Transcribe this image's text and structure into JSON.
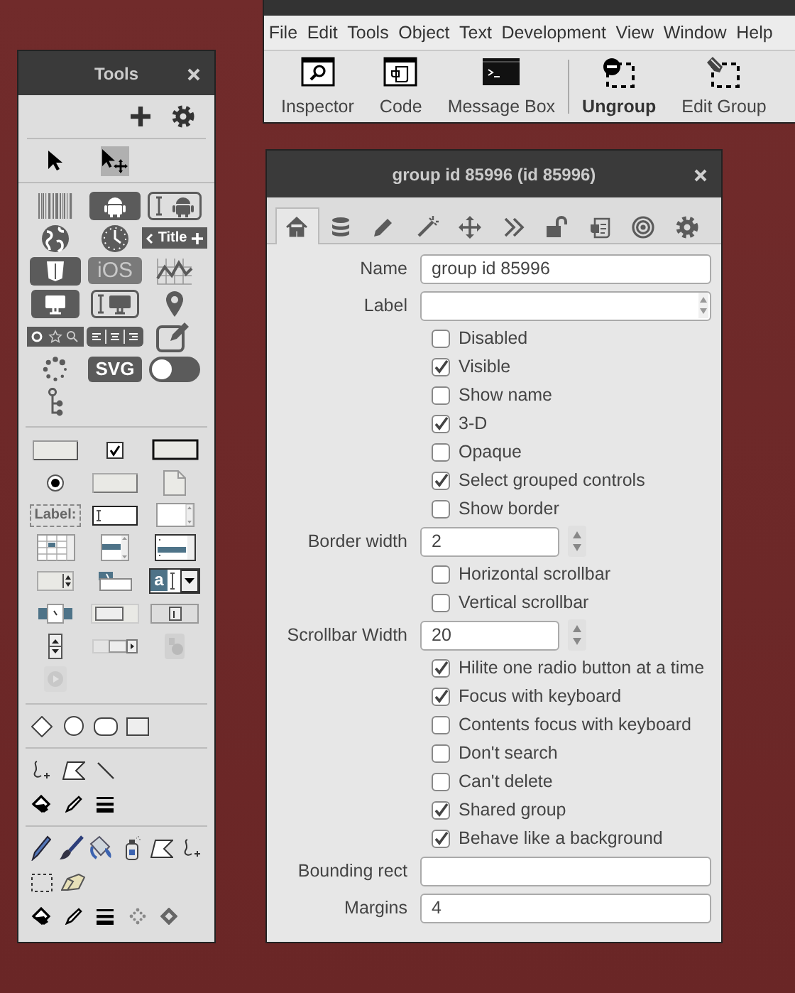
{
  "main_window": {
    "menu": [
      "File",
      "Edit",
      "Tools",
      "Object",
      "Text",
      "Development",
      "View",
      "Window",
      "Help"
    ],
    "toolbar_groups": [
      [
        {
          "kind": "inspector",
          "label": "Inspector",
          "emphasized": false
        },
        {
          "kind": "code",
          "label": "Code",
          "emphasized": false
        },
        {
          "kind": "console",
          "label": "Message Box",
          "emphasized": false
        }
      ],
      [
        {
          "kind": "ungroup",
          "label": "Ungroup",
          "emphasized": true
        },
        {
          "kind": "edit-group",
          "label": "Edit Group",
          "emphasized": false
        }
      ]
    ]
  },
  "tools": {
    "title": "Tools",
    "header_icons": [
      {
        "kind": "plus"
      },
      {
        "kind": "gear"
      }
    ],
    "pointers": [
      {
        "kind": "arrow",
        "selected": false
      },
      {
        "kind": "arrow-move",
        "selected": true
      }
    ],
    "sections": [
      {
        "kind": "grid",
        "rows": [
          [
            {
              "kind": "barcode"
            },
            {
              "kind": "android"
            },
            {
              "kind": "android-field"
            }
          ],
          [
            {
              "kind": "globe"
            },
            {
              "kind": "clock"
            },
            {
              "kind": "navbar",
              "label": "Title"
            }
          ],
          [
            {
              "kind": "html5"
            },
            {
              "kind": "ios",
              "label": "iOS"
            },
            {
              "kind": "chart"
            }
          ],
          [
            {
              "kind": "monitor"
            },
            {
              "kind": "monitor-field"
            },
            {
              "kind": "pin"
            }
          ],
          [
            {
              "kind": "icon-bar"
            },
            {
              "kind": "segmented"
            },
            {
              "kind": "edit"
            }
          ],
          [
            {
              "kind": "spinner"
            },
            {
              "kind": "svg",
              "label": "SVG"
            },
            {
              "kind": "toggle"
            }
          ],
          [
            {
              "kind": "tree"
            }
          ]
        ]
      },
      {
        "kind": "grid",
        "rows": [
          [
            {
              "kind": "button"
            },
            {
              "kind": "checkbox"
            },
            {
              "kind": "default-button"
            }
          ],
          [
            {
              "kind": "radio"
            },
            {
              "kind": "rect-button"
            },
            {
              "kind": "card"
            }
          ],
          [
            {
              "kind": "label-tag",
              "label": "Label:"
            },
            {
              "kind": "field"
            },
            {
              "kind": "scrolling-field"
            }
          ],
          [
            {
              "kind": "table"
            },
            {
              "kind": "list"
            },
            {
              "kind": "list2"
            }
          ],
          [
            {
              "kind": "option"
            },
            {
              "kind": "popup"
            },
            {
              "kind": "combo",
              "label": "a"
            }
          ],
          [
            {
              "kind": "tab-slider"
            },
            {
              "kind": "progress"
            },
            {
              "kind": "slider"
            }
          ],
          [
            {
              "kind": "stepper"
            },
            {
              "kind": "scrollbar"
            },
            {
              "kind": "image"
            }
          ],
          [
            {
              "kind": "player"
            }
          ]
        ]
      },
      {
        "kind": "strip",
        "rows": [
          [
            {
              "kind": "diamond"
            },
            {
              "kind": "oval"
            },
            {
              "kind": "rounded-rect"
            },
            {
              "kind": "rectangle"
            }
          ]
        ]
      },
      {
        "kind": "strip",
        "rows": [
          [
            {
              "kind": "freehand"
            },
            {
              "kind": "polygon"
            },
            {
              "kind": "line"
            }
          ],
          [
            {
              "kind": "paint-can"
            },
            {
              "kind": "pen"
            },
            {
              "kind": "line-widths"
            }
          ]
        ]
      },
      {
        "kind": "strip",
        "rows": [
          [
            {
              "kind": "pencil"
            },
            {
              "kind": "brush"
            },
            {
              "kind": "bucket"
            },
            {
              "kind": "spray"
            },
            {
              "kind": "polygon"
            },
            {
              "kind": "freehand"
            }
          ],
          [
            {
              "kind": "marquee"
            },
            {
              "kind": "eraser"
            }
          ],
          [
            {
              "kind": "paint-can"
            },
            {
              "kind": "pen"
            },
            {
              "kind": "line-widths"
            },
            {
              "kind": "dotted-diamond"
            },
            {
              "kind": "thick-diamond"
            }
          ]
        ]
      }
    ]
  },
  "inspector": {
    "title": "group id 85996 (id 85996)",
    "tabs": [
      {
        "kind": "home",
        "selected": true
      },
      {
        "kind": "database",
        "selected": false
      },
      {
        "kind": "pencil",
        "selected": false
      },
      {
        "kind": "wand",
        "selected": false
      },
      {
        "kind": "move",
        "selected": false
      },
      {
        "kind": "chevrons",
        "selected": false
      },
      {
        "kind": "lock",
        "selected": false
      },
      {
        "kind": "script",
        "selected": false
      },
      {
        "kind": "target",
        "selected": false
      },
      {
        "kind": "gear",
        "selected": false
      }
    ],
    "rows": [
      {
        "kind": "field",
        "label": "Name",
        "value": "group id 85996"
      },
      {
        "kind": "scroll-field",
        "label": "Label"
      },
      {
        "kind": "checkbox",
        "label": "Disabled",
        "checked": false
      },
      {
        "kind": "checkbox",
        "label": "Visible",
        "checked": true
      },
      {
        "kind": "checkbox",
        "label": "Show name",
        "checked": false
      },
      {
        "kind": "checkbox",
        "label": "3-D",
        "checked": true
      },
      {
        "kind": "checkbox",
        "label": "Opaque",
        "checked": false
      },
      {
        "kind": "checkbox",
        "label": "Select grouped controls",
        "checked": true
      },
      {
        "kind": "checkbox",
        "label": "Show border",
        "checked": false
      },
      {
        "kind": "spin-field",
        "label": "Border width",
        "value": "2"
      },
      {
        "kind": "checkbox",
        "label": "Horizontal scrollbar",
        "checked": false
      },
      {
        "kind": "checkbox",
        "label": "Vertical scrollbar",
        "checked": false
      },
      {
        "kind": "spin-field",
        "label": "Scrollbar Width",
        "value": "20"
      },
      {
        "kind": "checkbox",
        "label": "Hilite one radio button at a time",
        "checked": true
      },
      {
        "kind": "checkbox",
        "label": "Focus with keyboard",
        "checked": true
      },
      {
        "kind": "checkbox",
        "label": "Contents focus with keyboard",
        "checked": false
      },
      {
        "kind": "checkbox",
        "label": "Don't search",
        "checked": false
      },
      {
        "kind": "checkbox",
        "label": "Can't delete",
        "checked": false
      },
      {
        "kind": "checkbox",
        "label": "Shared group",
        "checked": true
      },
      {
        "kind": "checkbox",
        "label": "Behave like a background",
        "checked": true
      },
      {
        "kind": "field",
        "label": "Bounding rect"
      },
      {
        "kind": "field",
        "label": "Margins",
        "value": "4"
      }
    ]
  }
}
